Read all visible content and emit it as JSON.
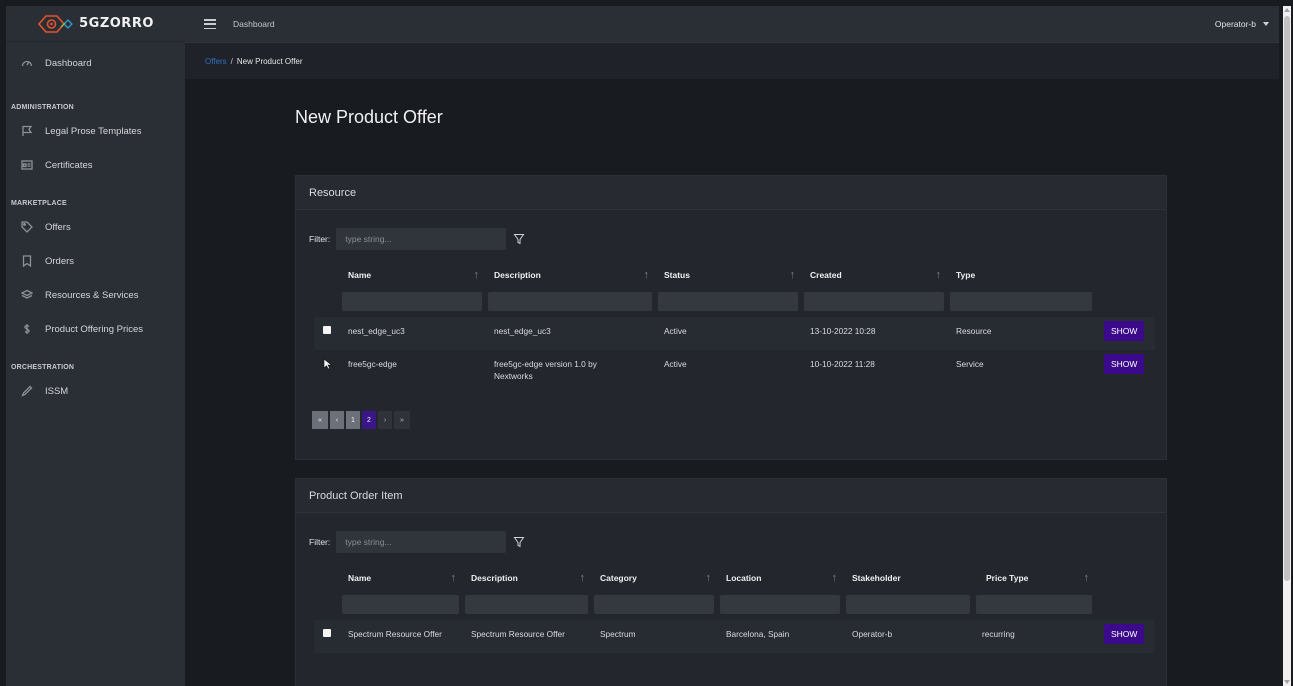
{
  "app": {
    "brand": "5GZORRO"
  },
  "header": {
    "dashboard_link": "Dashboard",
    "user": "Operator-b"
  },
  "breadcrumb": {
    "parent": "Offers",
    "current": "New Product Offer"
  },
  "sidebar": {
    "dashboard": "Dashboard",
    "sections": [
      {
        "title": "ADMINISTRATION",
        "items": [
          {
            "label": "Legal Prose Templates",
            "icon": "flag-icon"
          },
          {
            "label": "Certificates",
            "icon": "certificate-icon"
          }
        ]
      },
      {
        "title": "MARKETPLACE",
        "items": [
          {
            "label": "Offers",
            "icon": "tag-icon"
          },
          {
            "label": "Orders",
            "icon": "bookmark-icon"
          },
          {
            "label": "Resources & Services",
            "icon": "layers-icon"
          },
          {
            "label": "Product Offering Prices",
            "icon": "dollar-icon"
          }
        ]
      },
      {
        "title": "ORCHESTRATION",
        "items": [
          {
            "label": "ISSM",
            "icon": "pen-icon"
          }
        ]
      }
    ]
  },
  "page": {
    "title": "New Product Offer"
  },
  "resource": {
    "title": "Resource",
    "filter_label": "Filter:",
    "filter_placeholder": "type string...",
    "columns": [
      "Name",
      "Description",
      "Status",
      "Created",
      "Type"
    ],
    "rows": [
      {
        "name": "nest_edge_uc3",
        "description": "nest_edge_uc3",
        "status": "Active",
        "created": "13-10-2022 10:28",
        "type": "Resource",
        "action": "SHOW"
      },
      {
        "name": "free5gc-edge",
        "description": "free5gc-edge version 1.0 by Nextworks",
        "status": "Active",
        "created": "10-10-2022 11:28",
        "type": "Service",
        "action": "SHOW"
      }
    ],
    "pagination": [
      "«",
      "‹",
      "1",
      "2",
      "›",
      "»"
    ],
    "current_page": "2"
  },
  "order_item": {
    "title": "Product Order Item",
    "filter_label": "Filter:",
    "filter_placeholder": "type string...",
    "columns": [
      "Name",
      "Description",
      "Category",
      "Location",
      "Stakeholder",
      "Price Type"
    ],
    "rows": [
      {
        "name": "Spectrum Resource Offer",
        "description": "Spectrum Resource Offer",
        "category": "Spectrum",
        "location": "Barcelona, Spain",
        "stakeholder": "Operator-b",
        "price_type": "recurring",
        "action": "SHOW"
      }
    ]
  },
  "colors": {
    "accent": "#3a0a8a",
    "link": "#2e6fc0",
    "background": "#181b1f",
    "panel": "#2a2e35"
  }
}
